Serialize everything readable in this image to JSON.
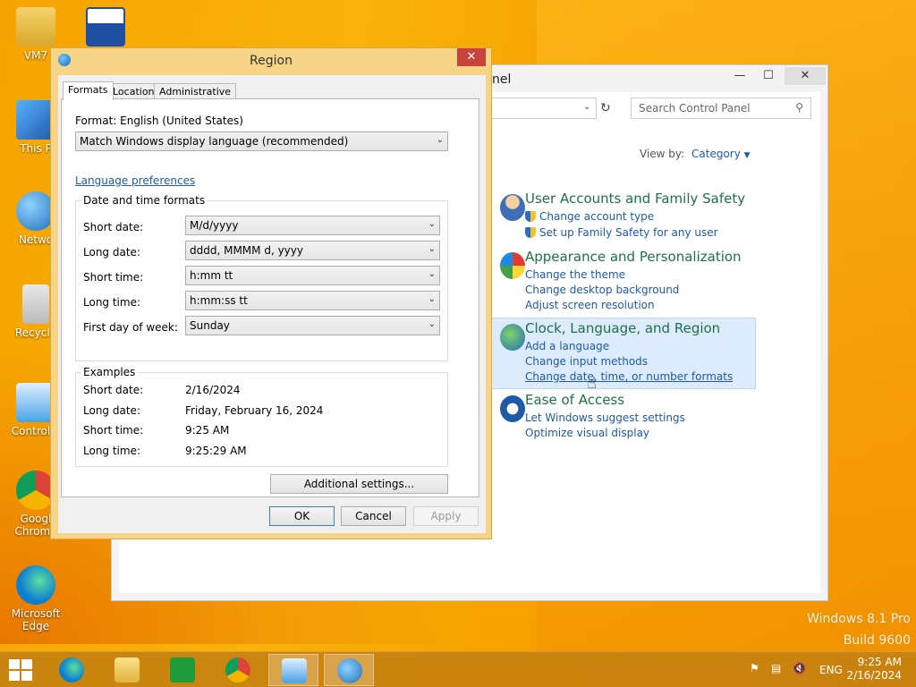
{
  "desktop": {
    "icons": [
      {
        "label": "VM7"
      },
      {
        "label": ""
      },
      {
        "label": "This P"
      },
      {
        "label": "Netwo"
      },
      {
        "label": "Recycle"
      },
      {
        "label": "Control P"
      },
      {
        "label": "Googl Chrome"
      },
      {
        "label": "Microsoft Edge"
      }
    ],
    "watermark": {
      "line1": "Windows 8.1 Pro",
      "line2": "Build 9600"
    }
  },
  "control_panel": {
    "title_partial": "nel",
    "search_placeholder": "Search Control Panel",
    "view_by_label": "View by:",
    "view_by_value": "Category",
    "categories": [
      {
        "heading": "User Accounts and Family Safety",
        "links": [
          "Change account type",
          "Set up Family Safety for any user"
        ]
      },
      {
        "heading": "Appearance and Personalization",
        "links": [
          "Change the theme",
          "Change desktop background",
          "Adjust screen resolution"
        ]
      },
      {
        "heading": "Clock, Language, and Region",
        "links": [
          "Add a language",
          "Change input methods",
          "Change date, time, or number formats"
        ]
      },
      {
        "heading": "Ease of Access",
        "links": [
          "Let Windows suggest settings",
          "Optimize visual display"
        ]
      }
    ]
  },
  "region_dialog": {
    "title": "Region",
    "tabs": [
      "Formats",
      "Location",
      "Administrative"
    ],
    "format_label": "Format: English (United States)",
    "format_value": "Match Windows display language (recommended)",
    "language_link": "Language preferences",
    "datetime_group": "Date and time formats",
    "fields": [
      {
        "label": "Short date:",
        "value": "M/d/yyyy"
      },
      {
        "label": "Long date:",
        "value": "dddd, MMMM d, yyyy"
      },
      {
        "label": "Short time:",
        "value": "h:mm tt"
      },
      {
        "label": "Long time:",
        "value": "h:mm:ss tt"
      },
      {
        "label": "First day of week:",
        "value": "Sunday"
      }
    ],
    "examples_group": "Examples",
    "examples": [
      {
        "label": "Short date:",
        "value": "2/16/2024"
      },
      {
        "label": "Long date:",
        "value": "Friday, February 16, 2024"
      },
      {
        "label": "Short time:",
        "value": "9:25 AM"
      },
      {
        "label": "Long time:",
        "value": "9:25:29 AM"
      }
    ],
    "additional_button": "Additional settings...",
    "ok": "OK",
    "cancel": "Cancel",
    "apply": "Apply"
  },
  "taskbar": {
    "language": "ENG",
    "time": "9:25 AM",
    "date": "2/16/2024"
  }
}
